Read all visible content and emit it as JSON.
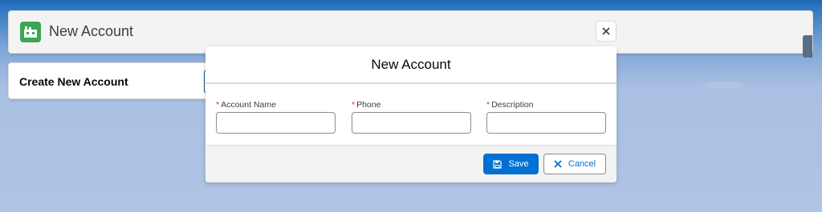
{
  "header": {
    "title": "New Account",
    "icon": "account-icon",
    "close_icon": "close-icon"
  },
  "card": {
    "title": "Create New Account"
  },
  "modal": {
    "title": "New Account",
    "fields": [
      {
        "label": "Account Name",
        "required": "*",
        "value": ""
      },
      {
        "label": "Phone",
        "required": "*",
        "value": ""
      },
      {
        "label": "Description",
        "required": "*",
        "value": ""
      }
    ],
    "footer": {
      "save_label": "Save",
      "save_icon": "save-icon",
      "cancel_label": "Cancel",
      "cancel_icon": "close-icon"
    }
  },
  "colors": {
    "brand_blue": "#0070d2",
    "account_icon_green": "#3ba755",
    "required_red": "#c23934",
    "header_bg": "#f3f3f3"
  }
}
